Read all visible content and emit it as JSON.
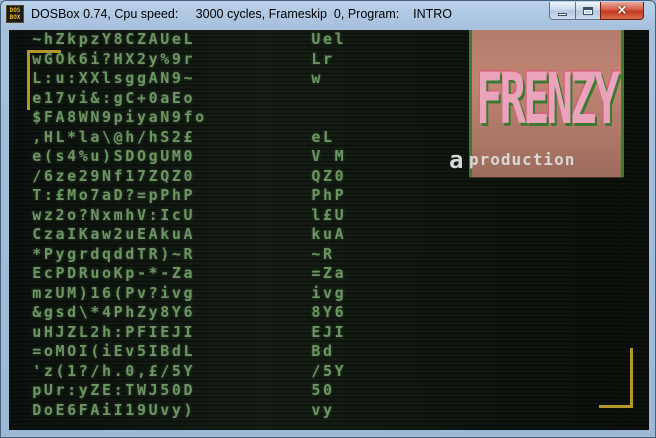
{
  "window": {
    "title": "DOSBox 0.74, Cpu speed:     3000 cycles, Frameskip  0, Program:    INTRO",
    "icon_lines": [
      "DOS",
      "BOX"
    ],
    "controls": {
      "minimize": "minimize",
      "maximize": "maximize",
      "close": "×"
    }
  },
  "screen": {
    "logo": {
      "word": "FRENZY",
      "prefix": "a",
      "suffix": "production"
    },
    "text_rain": [
      "  ~hZkpzY8CZAUeL          Uel",
      "  wGOk6i?HX2y%9r          Lr",
      "  L:u:XXlsggAN9~          w",
      "  e17vi&:gC+0aEo",
      "  $FA8WN9piyaN9fo",
      "  ,HL*la\\@h/hS2£          eL",
      "  e(s4%u)SDOgUM0          V M",
      "  /6ze29Nf17ZQZ0          QZ0",
      "  T:£Mo7aD?=pPhP          PhP",
      "  wz2o?NxmhV:IcU          l£U",
      "  CzaIKaw2uEAkuA          kuA",
      "  *PygrdqddTR)~R          ~R",
      "  EcPDRuoKp-*-Za          =Za",
      "  mzUM)16(Pv?ivg          ivg",
      "  &gsd\\*4PhZy8Y6          8Y6",
      "  uHJZL2h:PFIEJI          EJI",
      "  =oMOI(iEv5IBdL          Bd",
      "  'z(1?/h.0,£/5Y          /5Y",
      "  pUr:yZE:TWJ50D          50",
      "  DoE6FAiI19Uvy)          vy"
    ]
  }
}
